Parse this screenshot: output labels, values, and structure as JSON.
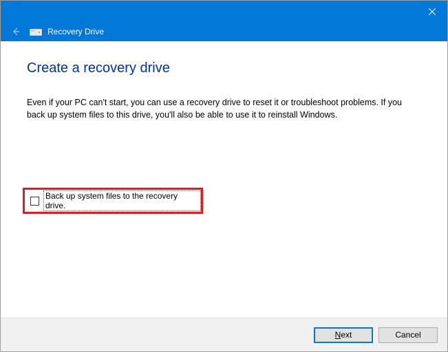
{
  "titlebar": {
    "close_tooltip": "Close"
  },
  "header": {
    "app_title": "Recovery Drive"
  },
  "page": {
    "heading": "Create a recovery drive",
    "description": "Even if your PC can't start, you can use a recovery drive to reset it or troubleshoot problems. If you back up system files to this drive, you'll also be able to use it to reinstall Windows."
  },
  "option": {
    "backup_label": "Back up system files to the recovery drive.",
    "checked": false
  },
  "footer": {
    "next_mnemonic": "N",
    "next_rest": "ext",
    "cancel_label": "Cancel"
  }
}
